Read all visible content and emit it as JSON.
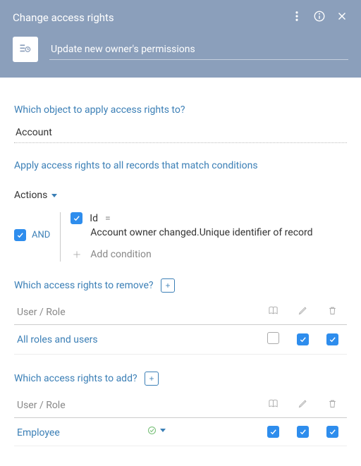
{
  "header": {
    "title": "Change access rights",
    "name": "Update new owner's permissions"
  },
  "sections": {
    "object_title": "Which object to apply access rights to?",
    "conditions_title": "Apply access rights to all records that match conditions",
    "remove_title": "Which access rights to remove?",
    "add_title": "Which access rights to add?"
  },
  "object": {
    "value": "Account"
  },
  "conditions": {
    "actions_label": "Actions",
    "group_op": "AND",
    "items": [
      {
        "field": "Id",
        "op": "=",
        "value": "Account owner changed.Unique identifier of record"
      }
    ],
    "add_label": "Add condition"
  },
  "table": {
    "col_user": "User / Role"
  },
  "remove_rights": [
    {
      "name": "All roles and users",
      "read": false,
      "edit": true,
      "delete": true
    }
  ],
  "add_rights": [
    {
      "name": "Employee",
      "read": true,
      "edit": true,
      "delete": true
    }
  ]
}
